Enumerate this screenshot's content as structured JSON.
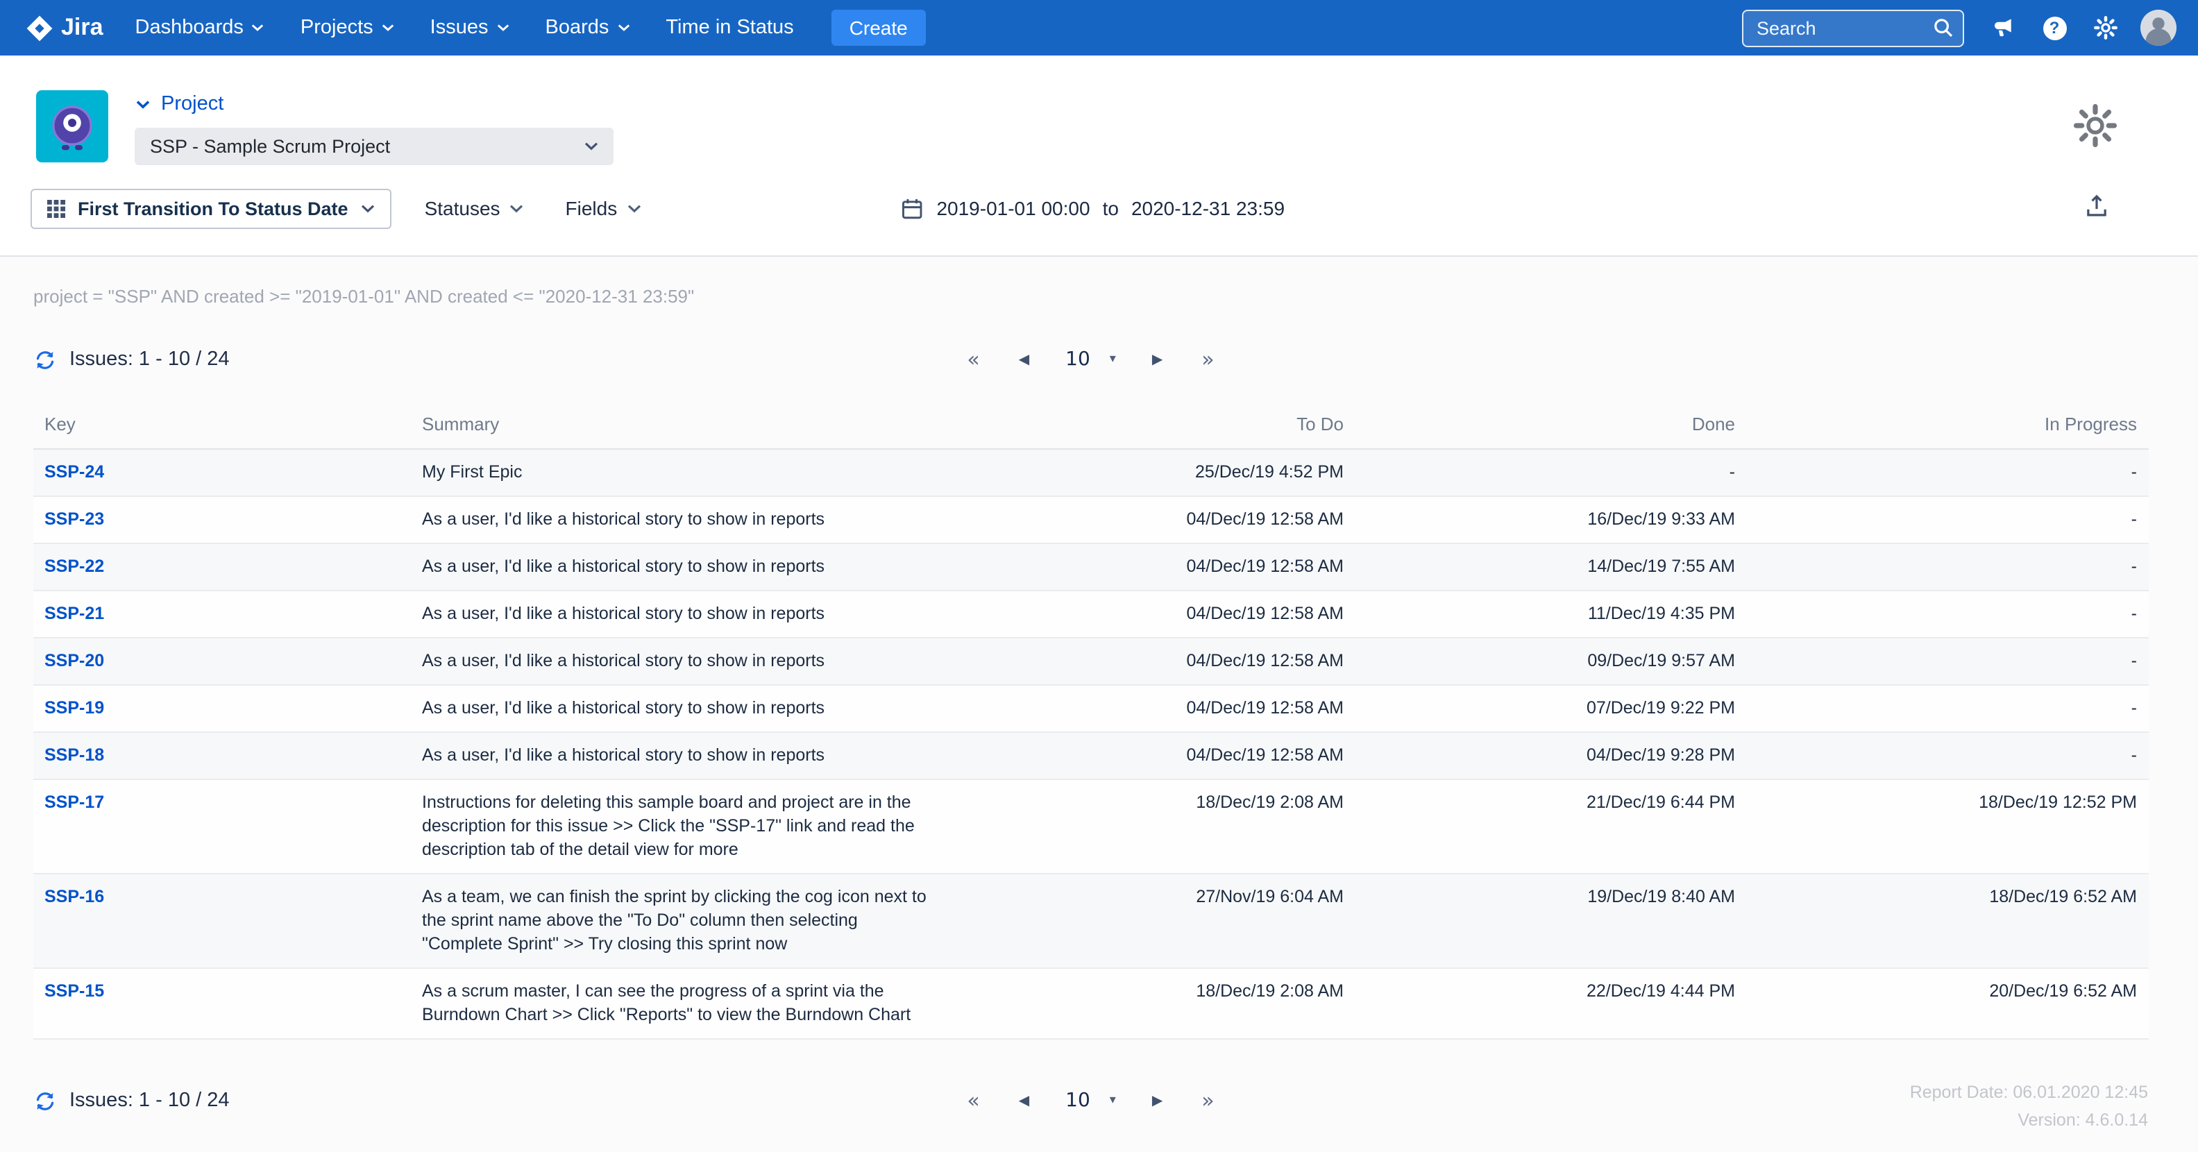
{
  "navbar": {
    "logo": "Jira",
    "items": [
      {
        "label": "Dashboards"
      },
      {
        "label": "Projects"
      },
      {
        "label": "Issues"
      },
      {
        "label": "Boards"
      },
      {
        "label": "Time in Status"
      }
    ],
    "create": "Create",
    "search_placeholder": "Search"
  },
  "header": {
    "project_label": "Project",
    "project_value": "SSP - Sample Scrum Project"
  },
  "toolbar": {
    "report_type": "First Transition To Status Date",
    "statuses": "Statuses",
    "fields": "Fields",
    "date_from": "2019-01-01 00:00",
    "to": "to",
    "date_to": "2020-12-31 23:59"
  },
  "filters": {
    "jql": "project = \"SSP\" AND created >= \"2019-01-01\" AND created <= \"2020-12-31 23:59\""
  },
  "results": {
    "count_label": "Issues: 1 - 10 / 24",
    "page_size": "10"
  },
  "pagination": {
    "first": "«",
    "prev": "◀",
    "next": "▶",
    "last": "»",
    "caret": "▾"
  },
  "table": {
    "columns": {
      "key": "Key",
      "summary": "Summary",
      "todo": "To Do",
      "done": "Done",
      "inprogress": "In Progress"
    },
    "rows": [
      {
        "key": "SSP-24",
        "summary": "My First Epic",
        "todo": "25/Dec/19 4:52 PM",
        "done": "-",
        "inprogress": "-"
      },
      {
        "key": "SSP-23",
        "summary": "As a user, I'd like a historical story to show in reports",
        "todo": "04/Dec/19 12:58 AM",
        "done": "16/Dec/19 9:33 AM",
        "inprogress": "-"
      },
      {
        "key": "SSP-22",
        "summary": "As a user, I'd like a historical story to show in reports",
        "todo": "04/Dec/19 12:58 AM",
        "done": "14/Dec/19 7:55 AM",
        "inprogress": "-"
      },
      {
        "key": "SSP-21",
        "summary": "As a user, I'd like a historical story to show in reports",
        "todo": "04/Dec/19 12:58 AM",
        "done": "11/Dec/19 4:35 PM",
        "inprogress": "-"
      },
      {
        "key": "SSP-20",
        "summary": "As a user, I'd like a historical story to show in reports",
        "todo": "04/Dec/19 12:58 AM",
        "done": "09/Dec/19 9:57 AM",
        "inprogress": "-"
      },
      {
        "key": "SSP-19",
        "summary": "As a user, I'd like a historical story to show in reports",
        "todo": "04/Dec/19 12:58 AM",
        "done": "07/Dec/19 9:22 PM",
        "inprogress": "-"
      },
      {
        "key": "SSP-18",
        "summary": "As a user, I'd like a historical story to show in reports",
        "todo": "04/Dec/19 12:58 AM",
        "done": "04/Dec/19 9:28 PM",
        "inprogress": "-"
      },
      {
        "key": "SSP-17",
        "summary": "Instructions for deleting this sample board and project are in the description for this issue >> Click the \"SSP-17\" link and read the description tab of the detail view for more",
        "todo": "18/Dec/19 2:08 AM",
        "done": "21/Dec/19 6:44 PM",
        "inprogress": "18/Dec/19 12:52 PM"
      },
      {
        "key": "SSP-16",
        "summary": "As a team, we can finish the sprint by clicking the cog icon next to the sprint name above the \"To Do\" column then selecting \"Complete Sprint\" >> Try closing this sprint now",
        "todo": "27/Nov/19 6:04 AM",
        "done": "19/Dec/19 8:40 AM",
        "inprogress": "18/Dec/19 6:52 AM"
      },
      {
        "key": "SSP-15",
        "summary": "As a scrum master, I can see the progress of a sprint via the Burndown Chart >> Click \"Reports\" to view the Burndown Chart",
        "todo": "18/Dec/19 2:08 AM",
        "done": "22/Dec/19 4:44 PM",
        "inprogress": "20/Dec/19 6:52 AM"
      }
    ]
  },
  "footer": {
    "report_date": "Report Date: 06.01.2020 12:45",
    "version": "Version: 4.6.0.14"
  },
  "colors": {
    "navbar": "#1765c3",
    "create_button": "#2f86f0",
    "link": "#0052CC",
    "accent_blue": "#0052CC"
  }
}
